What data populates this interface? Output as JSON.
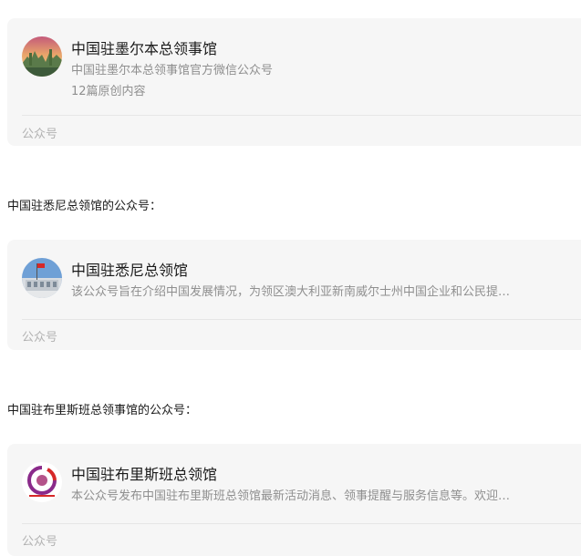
{
  "cards": [
    {
      "name": "中国驻墨尔本总领事馆",
      "desc": "中国驻墨尔本总领事馆官方微信公众号",
      "count": "12篇原创内容",
      "footer": "公众号",
      "avatar_icon": "landscape-avatar-icon"
    },
    {
      "name": "中国驻悉尼总领馆",
      "desc": "该公众号旨在介绍中国发展情况，为领区澳大利亚新南威尔士州中国企业和公民提…",
      "footer": "公众号",
      "avatar_icon": "consulate-building-avatar-icon"
    },
    {
      "name": "中国驻布里斯班总领馆",
      "desc": "本公众号发布中国驻布里斯班总领馆最新活动消息、领事提醒与服务信息等。欢迎…",
      "footer": "公众号",
      "avatar_icon": "emblem-logo-avatar-icon"
    }
  ],
  "intros": {
    "sydney": "中国驻悉尼总领馆的公众号：",
    "brisbane": "中国驻布里斯班总领事馆的公众号："
  },
  "colors": {
    "card_bg": "#f6f6f6",
    "title": "#1a1a1a",
    "desc": "#8f8f8f",
    "footer": "#b2b2b2"
  }
}
